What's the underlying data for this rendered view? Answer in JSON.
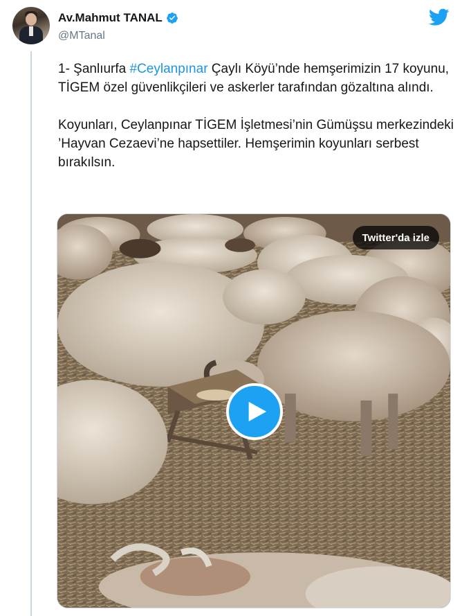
{
  "author": {
    "name": "Av.Mahmut TANAL",
    "handle": "@MTanal",
    "verified": true
  },
  "tweet": {
    "line1_prefix": "1- Şanlıurfa ",
    "hashtag": "#Ceylanpınar",
    "line1_suffix": " Çaylı Köyü’nde hemşerimizin 17 koyunu, TİGEM özel güvenlikçileri ve askerler tarafından gözaltına alındı.",
    "paragraph2": "Koyunları, Ceylanpınar TİGEM İşletmesi’nin Gümüşsu merkezindeki ’Hayvan Cezaevi’ne hapsettiler. Hemşerimin koyunları serbest bırakılsın."
  },
  "media": {
    "watch_label": "Twitter'da izle",
    "play_icon": "play-icon"
  },
  "colors": {
    "accent": "#1da1f2",
    "hashtag": "#1b95e0",
    "verified": "#1da1f2",
    "secondary_text": "#657786"
  },
  "icons": {
    "logo": "twitter-bird-icon",
    "verified": "verified-badge-icon"
  }
}
